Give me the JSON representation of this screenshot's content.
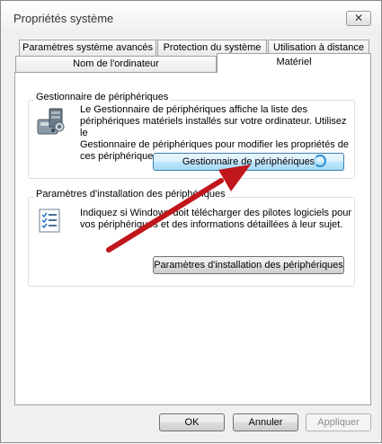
{
  "window": {
    "title": "Propriétés système",
    "close_glyph": "✕"
  },
  "tabs": {
    "row1": [
      "Paramètres système avancés",
      "Protection du système",
      "Utilisation à distance"
    ],
    "row2": [
      "Nom de l'ordinateur",
      "Matériel"
    ],
    "active": "Matériel"
  },
  "device_manager": {
    "group_title": "Gestionnaire de périphériques",
    "description_lines": [
      "Le Gestionnaire de périphériques affiche la liste des",
      "périphériques matériels installés sur votre ordinateur. Utilisez le",
      "Gestionnaire de périphériques pour modifier les propriétés de",
      "ces périphériques."
    ],
    "button_label": "Gestionnaire de périphériques",
    "icon": "device-manager-icon"
  },
  "install_settings": {
    "group_title": "Paramètres d'installation des périphériques",
    "description_lines": [
      "Indiquez si Windows doit télécharger des pilotes logiciels pour",
      "vos périphériques et des informations détaillées à leur sujet."
    ],
    "button_label": "Paramètres d'installation des périphériques",
    "icon": "checklist-icon"
  },
  "footer": {
    "ok_label": "OK",
    "cancel_label": "Annuler",
    "apply_label": "Appliquer"
  },
  "colors": {
    "arrow": "#c0171c",
    "focus_blue": "#3c7fb1"
  }
}
